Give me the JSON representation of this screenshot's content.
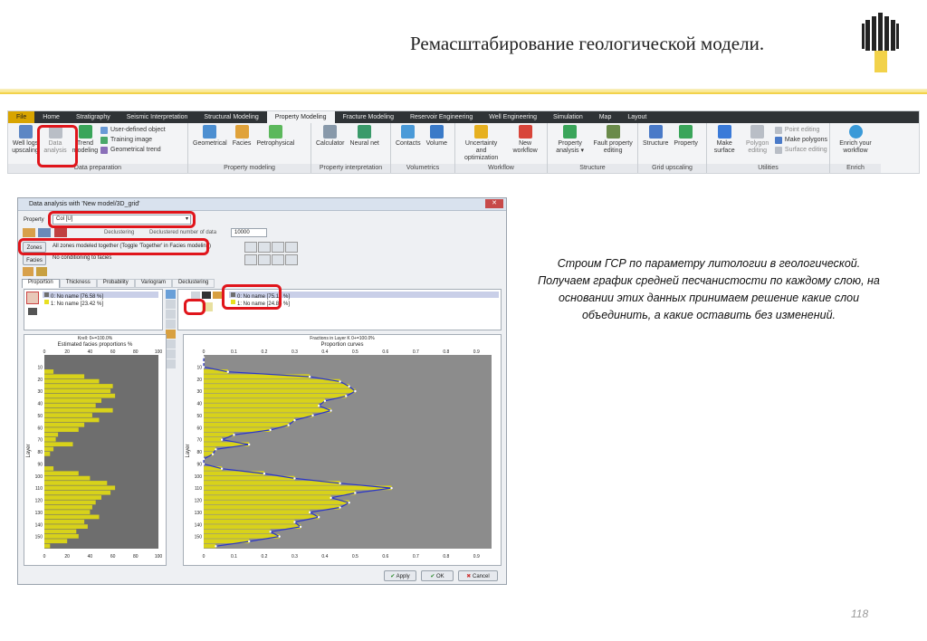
{
  "slide": {
    "title": "Ремасштабирование геологической модели.",
    "description": "Строим ГСР по параметру литологии в геологической. Получаем график средней песчанистости по каждому слою, на основании этих данных принимаем решение какие слои объединить, а какие оставить без изменений.",
    "page_number": "118",
    "accent_color": "#f2d24a",
    "highlight_color": "#e0151b"
  },
  "ribbon": {
    "tabs": [
      "File",
      "Home",
      "Stratigraphy",
      "Seismic Interpretation",
      "Structural Modeling",
      "Property Modeling",
      "Fracture Modeling",
      "Reservoir Engineering",
      "Well Engineering",
      "Simulation",
      "Map",
      "Layout"
    ],
    "active_tab": "Property Modeling",
    "groups": {
      "data_preparation": {
        "label": "Data preparation",
        "well_logs": "Well logs upscaling",
        "data_analysis": "Data analysis",
        "trend_modeling": "Trend modeling",
        "user_defined": "User-defined object",
        "training_image": "Training image",
        "geometrical_trend": "Geometrical trend"
      },
      "property_modeling": {
        "label": "Property modeling",
        "geometrical": "Geometrical",
        "facies": "Facies",
        "petrophysical": "Petrophysical"
      },
      "property_interpretation": {
        "label": "Property interpretation",
        "calculator": "Calculator",
        "neural_net": "Neural net"
      },
      "volumetrics": {
        "label": "Volumetrics",
        "contacts": "Contacts",
        "volume": "Volume"
      },
      "workflow": {
        "label": "Workflow",
        "uncertainty": "Uncertainty and optimization",
        "new_workflow": "New workflow"
      },
      "structure": {
        "label": "Structure",
        "property_analysis": "Property analysis ▾",
        "fault_property": "Fault property editing"
      },
      "grid_upscaling": {
        "label": "Grid upscaling",
        "structure": "Structure",
        "property": "Property"
      },
      "utilities": {
        "label": "Utilities",
        "make_surface": "Make surface",
        "polygon_editing": "Polygon editing",
        "point_editing": "Point editing",
        "make_polygons": "Make polygons",
        "surface_editing": "Surface editing"
      },
      "enrich": {
        "label": "Enrich",
        "enrich_workflow": "Enrich your workflow"
      }
    }
  },
  "dialog": {
    "title": "Data analysis with 'New model/3D_grid'",
    "property_label": "Property",
    "property_value": "Col [U]",
    "declustering_label": "Declustering",
    "declustered_label": "Declustered number of data",
    "declustered_value": "10000",
    "zones_label": "Zones",
    "zones_value": "All zones modeled together (Toggle 'Together' in Facies modeling)",
    "facies_label": "Facies",
    "facies_value": "No conditioning to facies",
    "tabs": [
      "Proportion",
      "Thickness",
      "Probability",
      "Variogram",
      "Declustering"
    ],
    "left_legend": [
      "0: No name [76.58 %]",
      "1: No name [23.42 %]"
    ],
    "right_legend": [
      "0: No name [75.16 %]",
      "1: No name [24.84 %]"
    ],
    "left_plot_header": "Estimated facies proportions %",
    "left_plot_caption": "Krell: 0+=100.0%",
    "right_plot_header": "Proportion curves",
    "right_plot_caption": "Fractions in Layer K 0+=100.0%",
    "y_axis_label": "Layer",
    "buttons": {
      "apply": "Apply",
      "ok": "OK",
      "cancel": "Cancel"
    }
  },
  "chart_data": [
    {
      "type": "bar",
      "title": "Estimated facies proportions %",
      "ylabel": "Layer",
      "x_ticks": [
        0,
        20,
        40,
        60,
        80,
        100
      ],
      "y_ticks": [
        10,
        20,
        30,
        40,
        50,
        60,
        70,
        80,
        90,
        100,
        110,
        120,
        130,
        140,
        150
      ],
      "ylim": [
        0,
        160
      ],
      "xlim": [
        0,
        100
      ],
      "series_colors": {
        "0": "#6e6e6e",
        "1": "#d8d21a"
      },
      "layers": [
        2,
        6,
        10,
        14,
        18,
        22,
        26,
        30,
        34,
        38,
        42,
        46,
        50,
        54,
        58,
        62,
        66,
        70,
        74,
        78,
        82,
        86,
        90,
        94,
        98,
        102,
        106,
        110,
        114,
        118,
        122,
        126,
        130,
        134,
        138,
        142,
        146,
        150,
        154,
        158
      ],
      "facies1_pct": [
        0,
        0,
        0,
        8,
        35,
        48,
        60,
        58,
        62,
        50,
        45,
        60,
        42,
        48,
        35,
        30,
        12,
        10,
        25,
        8,
        5,
        0,
        0,
        8,
        30,
        40,
        55,
        62,
        58,
        50,
        45,
        42,
        40,
        48,
        35,
        38,
        28,
        30,
        20,
        5
      ]
    },
    {
      "type": "line",
      "title": "Proportion curves",
      "ylabel": "Layer",
      "x_ticks": [
        0,
        0.1,
        0.2,
        0.3,
        0.4,
        0.5,
        0.6,
        0.7,
        0.8,
        0.9
      ],
      "y_ticks": [
        10,
        20,
        30,
        40,
        50,
        60,
        70,
        80,
        90,
        100,
        110,
        120,
        130,
        140,
        150
      ],
      "ylim": [
        0,
        160
      ],
      "xlim": [
        0,
        0.95
      ],
      "series_colors": {
        "fill": "#d8d21a",
        "curve": "#2a35c8"
      },
      "layers": [
        2,
        6,
        10,
        14,
        18,
        22,
        26,
        30,
        34,
        38,
        42,
        46,
        50,
        54,
        58,
        62,
        66,
        70,
        74,
        78,
        82,
        86,
        90,
        94,
        98,
        102,
        106,
        110,
        114,
        118,
        122,
        126,
        130,
        134,
        138,
        142,
        146,
        150,
        154,
        158
      ],
      "proportion": [
        0,
        0,
        0,
        0.08,
        0.35,
        0.45,
        0.48,
        0.5,
        0.47,
        0.4,
        0.38,
        0.42,
        0.36,
        0.3,
        0.28,
        0.22,
        0.1,
        0.06,
        0.15,
        0.04,
        0.03,
        0.0,
        0.0,
        0.06,
        0.2,
        0.3,
        0.45,
        0.62,
        0.5,
        0.42,
        0.48,
        0.45,
        0.35,
        0.38,
        0.3,
        0.32,
        0.22,
        0.25,
        0.15,
        0.04
      ]
    }
  ]
}
